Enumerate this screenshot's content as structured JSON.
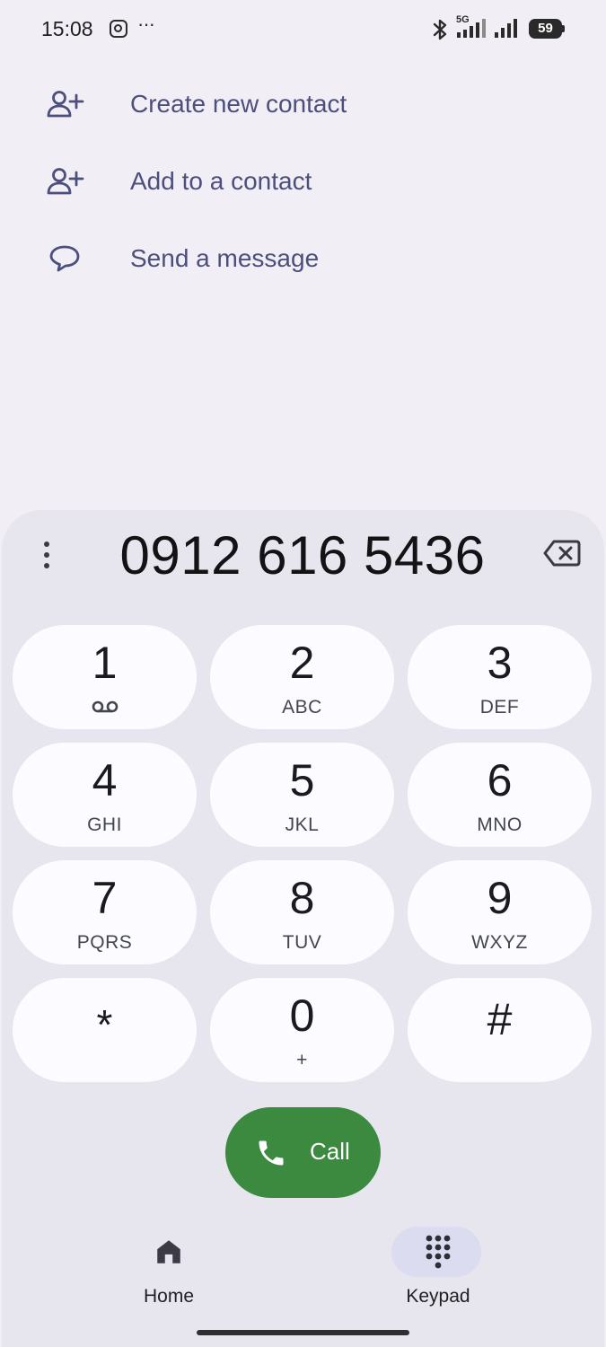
{
  "status_bar": {
    "time": "15:08",
    "network_type": "5G",
    "battery_level": "59",
    "icons": [
      "instagram-icon",
      "more-dots-icon",
      "bluetooth-icon",
      "signal-5g-icon",
      "signal-icon",
      "battery-icon"
    ]
  },
  "actions": [
    {
      "label": "Create new contact",
      "icon": "add-person-icon"
    },
    {
      "label": "Add to a contact",
      "icon": "add-person-icon"
    },
    {
      "label": "Send a message",
      "icon": "message-bubble-icon"
    }
  ],
  "dialer": {
    "number": "0912 616 5436",
    "keys": [
      {
        "digit": "1",
        "letters": "",
        "icon": "voicemail-icon"
      },
      {
        "digit": "2",
        "letters": "ABC"
      },
      {
        "digit": "3",
        "letters": "DEF"
      },
      {
        "digit": "4",
        "letters": "GHI"
      },
      {
        "digit": "5",
        "letters": "JKL"
      },
      {
        "digit": "6",
        "letters": "MNO"
      },
      {
        "digit": "7",
        "letters": "PQRS"
      },
      {
        "digit": "8",
        "letters": "TUV"
      },
      {
        "digit": "9",
        "letters": "WXYZ"
      },
      {
        "digit": "*",
        "letters": ""
      },
      {
        "digit": "0",
        "letters": "+"
      },
      {
        "digit": "#",
        "letters": ""
      }
    ],
    "call_label": "Call"
  },
  "bottom_nav": [
    {
      "label": "Home",
      "icon": "home-icon",
      "active": false
    },
    {
      "label": "Keypad",
      "icon": "keypad-icon",
      "active": true
    }
  ],
  "colors": {
    "background": "#f1eff5",
    "sheet": "#e7e6ef",
    "key": "#fcfbff",
    "accent_text": "#4c4e7d",
    "call_green": "#3b8a40",
    "nav_active": "#dcdcf1"
  }
}
